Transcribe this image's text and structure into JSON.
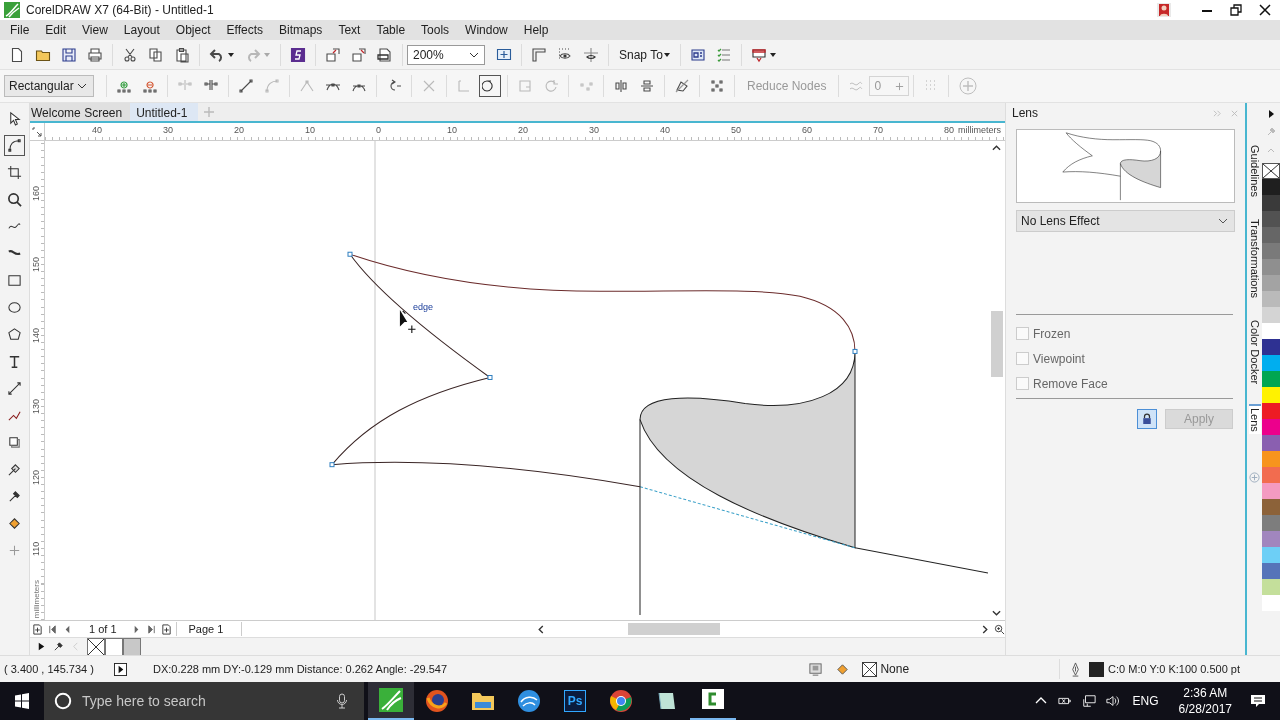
{
  "window": {
    "title": "CorelDRAW X7 (64-Bit) - Untitled-1"
  },
  "menu": [
    "File",
    "Edit",
    "View",
    "Layout",
    "Object",
    "Effects",
    "Bitmaps",
    "Text",
    "Table",
    "Tools",
    "Window",
    "Help"
  ],
  "standard_toolbar": {
    "zoom": "200%",
    "snap_to": "Snap To"
  },
  "property_bar": {
    "selection_mode": "Rectangular",
    "reduce_nodes": "Reduce Nodes",
    "curve_smoothness": "0"
  },
  "document_tabs": [
    {
      "label": "Welcome Screen",
      "selected": false
    },
    {
      "label": "Untitled-1",
      "selected": true
    }
  ],
  "horizontal_ruler": {
    "labels": [
      "40",
      "30",
      "20",
      "10",
      "0",
      "10",
      "20",
      "30",
      "40",
      "50",
      "60",
      "70",
      "80"
    ],
    "unit": "millimeters"
  },
  "vertical_ruler": {
    "labels": [
      "160",
      "150",
      "140",
      "130",
      "120",
      "110"
    ],
    "unit": "millimeters"
  },
  "canvas": {
    "snap_label": "edge"
  },
  "page_navigator": {
    "count": "1 of 1",
    "page_tab": "Page 1"
  },
  "lens_docker": {
    "title": "Lens",
    "effect": "No Lens Effect",
    "options": [
      {
        "label": "Frozen",
        "checked": false
      },
      {
        "label": "Viewpoint",
        "checked": false
      },
      {
        "label": "Remove Face",
        "checked": false
      }
    ],
    "apply_button": {
      "label": "Apply",
      "disabled": true
    }
  },
  "docker_tabs": [
    {
      "label": "Guidelines",
      "selected": false
    },
    {
      "label": "Transformations",
      "selected": false
    },
    {
      "label": "Color Docker",
      "selected": false
    },
    {
      "label": "Lens",
      "selected": true
    }
  ],
  "color_palette": [
    {
      "color": "#1f1f1f"
    },
    {
      "color": "#3a3a3a"
    },
    {
      "color": "#525252"
    },
    {
      "color": "#666666"
    },
    {
      "color": "#7a7a7a"
    },
    {
      "color": "#8f8f8f"
    },
    {
      "color": "#a3a3a3"
    },
    {
      "color": "#bababa"
    },
    {
      "color": "#d4d4d4"
    },
    {
      "color": "#ffffff"
    },
    {
      "color": "#2e3192"
    },
    {
      "color": "#00aeef"
    },
    {
      "color": "#00a651"
    },
    {
      "color": "#fff200"
    },
    {
      "color": "#ed1c24"
    },
    {
      "color": "#ec008c"
    },
    {
      "color": "#8a5fb0"
    },
    {
      "color": "#f7941d"
    },
    {
      "color": "#f26c4f"
    },
    {
      "color": "#f49ac1"
    },
    {
      "color": "#8c6239"
    },
    {
      "color": "#7d7d7d"
    },
    {
      "color": "#a186be"
    },
    {
      "color": "#6dcff6"
    },
    {
      "color": "#5674b9"
    },
    {
      "color": "#c4df9b"
    },
    {
      "color": "#ffffff"
    }
  ],
  "status_bar": {
    "cursor_position": "( 3.400 , 145.734 )",
    "measurement": "DX:0.228 mm DY:-0.129 mm Distance: 0.262 Angle: -29.547",
    "fill": "None",
    "outline": "C:0 M:0 Y:0 K:100  0.500 pt"
  },
  "taskbar": {
    "search_placeholder": "Type here to search",
    "app_badge": "Ps",
    "language": "ENG",
    "time": "2:36 AM",
    "date": "6/28/2017"
  }
}
